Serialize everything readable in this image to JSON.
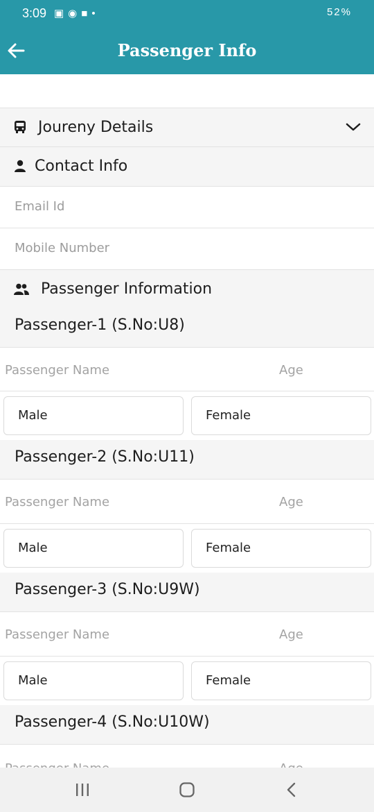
{
  "status": {
    "time": "3:09",
    "battery": "52%"
  },
  "appbar": {
    "title": "Passenger Info"
  },
  "sections": {
    "journey": "Joureny Details",
    "contact": "Contact Info",
    "passenger_info": "Passenger Information"
  },
  "contact": {
    "email_placeholder": "Email Id",
    "mobile_placeholder": "Mobile Number"
  },
  "passengers": [
    {
      "header": "Passenger-1 (S.No:U8)",
      "name_placeholder": "Passenger Name",
      "age_placeholder": "Age",
      "male": "Male",
      "female": "Female"
    },
    {
      "header": "Passenger-2 (S.No:U11)",
      "name_placeholder": "Passenger Name",
      "age_placeholder": "Age",
      "male": "Male",
      "female": "Female"
    },
    {
      "header": "Passenger-3 (S.No:U9W)",
      "name_placeholder": "Passenger Name",
      "age_placeholder": "Age",
      "male": "Male",
      "female": "Female"
    },
    {
      "header": "Passenger-4 (S.No:U10W)",
      "name_placeholder": "Passenger Name",
      "age_placeholder": "Age"
    }
  ],
  "colors": {
    "primary": "#2898a8",
    "section_bg": "#f5f5f5",
    "placeholder": "#9c9c9c"
  },
  "icons": {
    "back": "arrow-left-icon",
    "journey": "bus-icon",
    "expand": "chevron-down-icon",
    "contact": "person-icon",
    "passengers": "people-icon"
  }
}
